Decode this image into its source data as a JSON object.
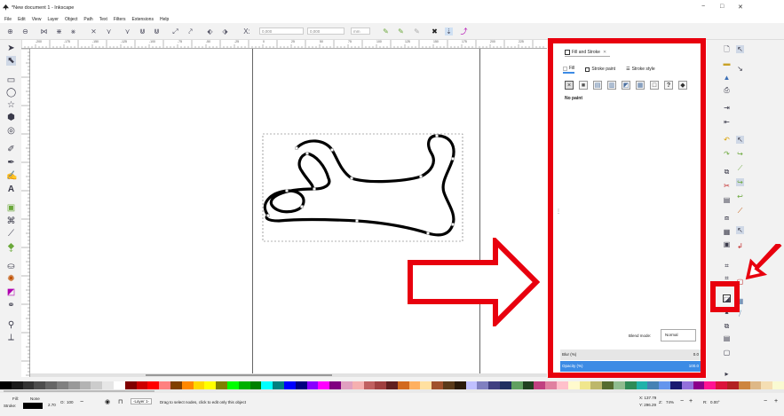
{
  "window": {
    "title": "*New document 1 - Inkscape",
    "controls": [
      "−",
      "□",
      "✕"
    ]
  },
  "menu": [
    "File",
    "Edit",
    "View",
    "Layer",
    "Object",
    "Path",
    "Text",
    "Filters",
    "Extensions",
    "Help"
  ],
  "toolbar": {
    "x_label": "X:",
    "x_value": "0,000",
    "y_label": "Y:",
    "y_value": "0,000",
    "unit": "mm"
  },
  "ruler_labels": [
    "-200",
    "-175",
    "-150",
    "-125",
    "-100",
    "-75",
    "-50",
    "-25",
    "0",
    "25",
    "50",
    "75",
    "100",
    "125",
    "150",
    "175",
    "200",
    "225",
    "250"
  ],
  "dock": {
    "tab_title": "Fill and Stroke",
    "subtabs": [
      "Fill",
      "Stroke paint",
      "Stroke style"
    ],
    "paint_buttons": [
      "×",
      "■",
      "▤",
      "▥",
      "◩",
      "▦",
      "□",
      "?",
      "◆"
    ],
    "fill_status": "No paint",
    "blend_label": "Blend mode:",
    "blend_value": "Normal",
    "blur_label": "Blur (%)",
    "blur_value": "0.0",
    "opacity_label": "Opacity (%)",
    "opacity_value": "100.0"
  },
  "status": {
    "fill_label": "Fill:",
    "fill_value": "None",
    "stroke_label": "Stroke:",
    "stroke_width": "2.70",
    "opacity_label": "O:",
    "opacity_value": "100",
    "layer": "-Layer 1-",
    "message": "Drag to select nodes, click to edit only this object",
    "x_coord": "X: 137.79",
    "y_coord": "Y: 296.29",
    "zoom_label": "Z:",
    "zoom_value": "74%",
    "rotation_label": "R:",
    "rotation_value": "0.00°"
  },
  "colors": {
    "highlight": "#e8000e",
    "accent": "#3c8be5"
  }
}
